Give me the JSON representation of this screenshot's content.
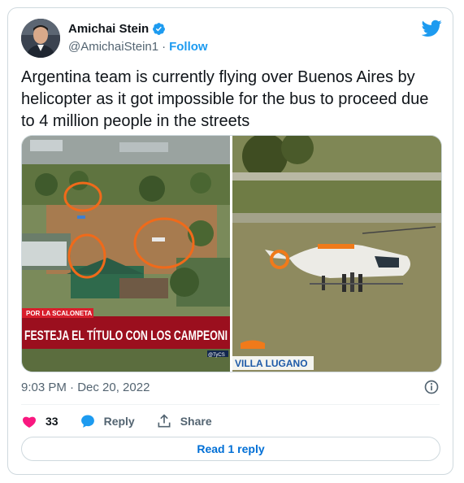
{
  "author": {
    "name": "Amichai Stein",
    "handle": "@AmichaiStein1",
    "separator": "·",
    "follow_label": "Follow"
  },
  "tweet": {
    "text": "Argentina team is currently flying over Buenos Aires by helicopter as it got impossible for the bus to proceed due to 4 million people in the streets",
    "timestamp": "9:03 PM · Dec 20, 2022"
  },
  "media": {
    "left": {
      "tag": "POR LA SCALONETA",
      "headline": "FESTEJA EL TÍTULO CON LOS CAMPEONI",
      "watermark": "@TyCS"
    },
    "right": {
      "location_label": "VILLA LUGANO"
    }
  },
  "actions": {
    "like_count": "33",
    "reply_label": "Reply",
    "share_label": "Share"
  },
  "read_reply_label": "Read 1 reply",
  "colors": {
    "accent": "#1d9bf0",
    "like": "#f91880",
    "link": "#006fd6"
  }
}
